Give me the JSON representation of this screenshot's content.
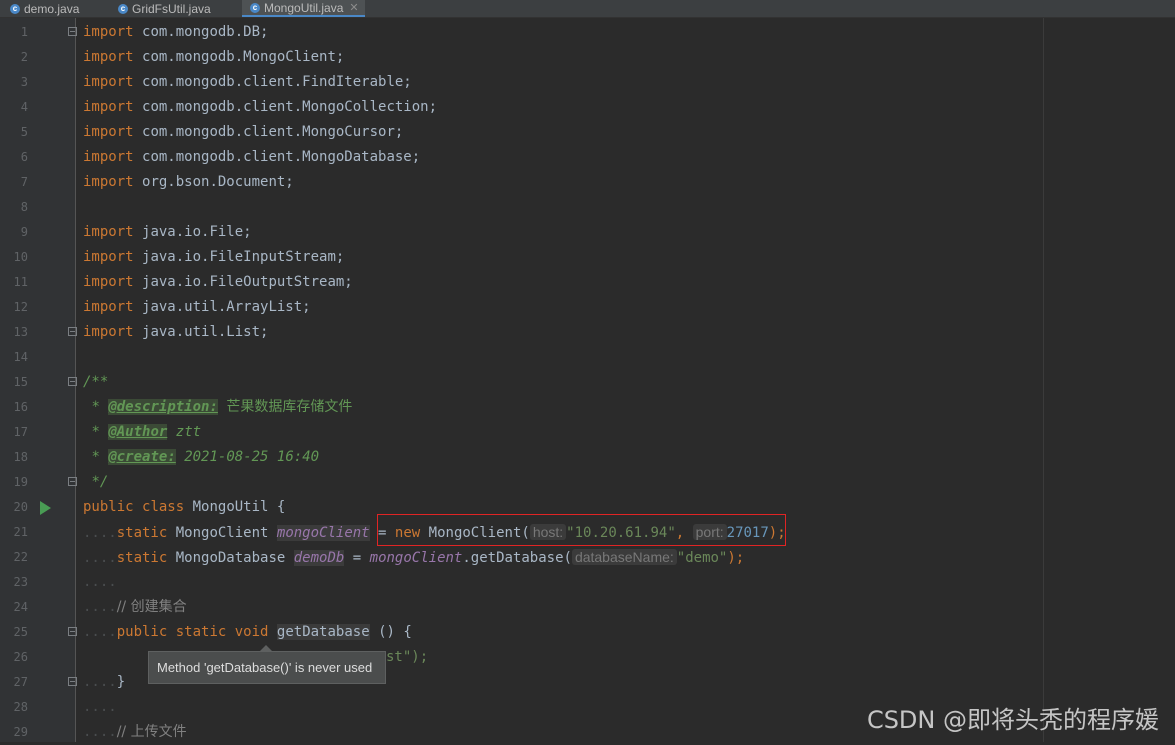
{
  "tabs": [
    {
      "label": "demo.java",
      "active": false
    },
    {
      "label": "GridFsUtil.java",
      "active": false
    },
    {
      "label": "MongoUtil.java",
      "active": true
    }
  ],
  "line_numbers": [
    "1",
    "2",
    "3",
    "4",
    "5",
    "6",
    "7",
    "8",
    "9",
    "10",
    "11",
    "12",
    "13",
    "14",
    "15",
    "16",
    "17",
    "18",
    "19",
    "20",
    "21",
    "22",
    "23",
    "24",
    "25",
    "26",
    "27",
    "28",
    "29"
  ],
  "code": {
    "import_kw": "import",
    "l1": "com.mongodb.DB;",
    "l2": "com.mongodb.MongoClient;",
    "l3": "com.mongodb.client.FindIterable;",
    "l4": "com.mongodb.client.MongoCollection;",
    "l5": "com.mongodb.client.MongoCursor;",
    "l6": "com.mongodb.client.MongoDatabase;",
    "l7": "org.bson.Document;",
    "l9": "java.io.File;",
    "l10": "java.io.FileInputStream;",
    "l11": "java.io.FileOutputStream;",
    "l12": "java.util.ArrayList;",
    "l13": "java.util.List;",
    "c_open": "/**",
    "c_star": "*",
    "desc_tag": "@description:",
    "desc_text": "芒果数据库存储文件",
    "author_tag": "@Author",
    "author_text": "ztt",
    "create_tag": "@create:",
    "create_text": "2021-08-25 16:40",
    "c_close": "*/",
    "public_kw": "public",
    "class_kw": "class",
    "static_kw": "static",
    "void_kw": "void",
    "new_kw": "new",
    "class_name": "MongoUtil",
    "open_brace": "{",
    "close_brace": "}",
    "mongo_client_type": "MongoClient",
    "mongo_client_field": "mongoClient",
    "eq": "=",
    "ctor_open": "MongoClient(",
    "hint_host": "host:",
    "host_value": "\"10.20.61.94\"",
    "comma": ",",
    "hint_port": "port:",
    "port_value": "27017",
    "stmt_end": ");",
    "mongo_db_type": "MongoDatabase",
    "demo_db_field": "demoDb",
    "get_db_call": ".getDatabase(",
    "hint_db_name": "databaseName:",
    "db_name_value": "\"demo\"",
    "comment_collection": "// 创建集合",
    "method_name": "getDatabase",
    "method_parens": "()",
    "l26_tail": "st\");",
    "comment_upload": "// 上传文件"
  },
  "tooltip": "Method 'getDatabase()' is never used",
  "watermark": "CSDN @即将头秃的程序媛"
}
